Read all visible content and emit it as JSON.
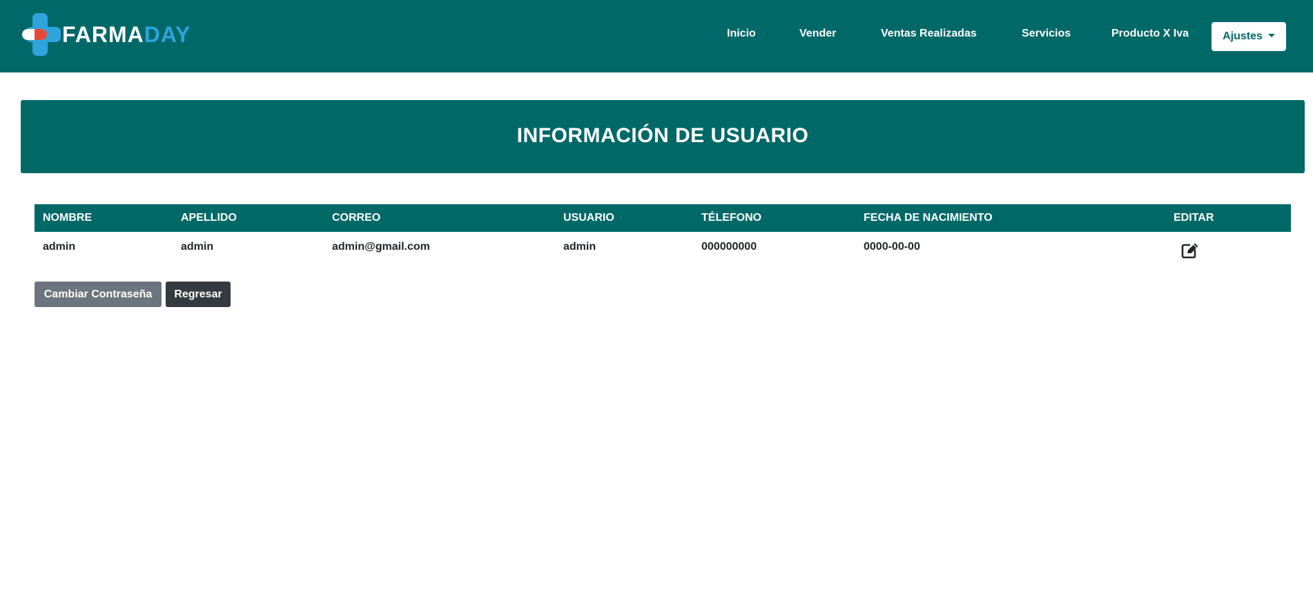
{
  "navbar": {
    "brand": {
      "part1": "FARMA",
      "part2": "DAY"
    },
    "links": [
      "Inicio",
      "Vender",
      "Ventas Realizadas",
      "Servicios",
      "Producto X Iva"
    ],
    "settings_label": "Ajustes"
  },
  "banner": {
    "title": "INFORMACIÓN DE USUARIO"
  },
  "table": {
    "headers": [
      "NOMBRE",
      "APELLIDO",
      "CORREO",
      "USUARIO",
      "TÉLEFONO",
      "FECHA DE NACIMIENTO",
      "EDITAR"
    ],
    "row": {
      "nombre": "admin",
      "apellido": "admin",
      "correo": "admin@gmail.com",
      "usuario": "admin",
      "telefono": "000000000",
      "fecha": "0000-00-00"
    }
  },
  "actions": {
    "change_password": "Cambiar Contraseña",
    "back": "Regresar"
  },
  "colors": {
    "primary": "#016868",
    "brand_accent": "#2ea3dc",
    "pill_red": "#e34a3a",
    "secondary": "#6c757d",
    "dark": "#343a40"
  },
  "icons": {
    "edit": "edit-icon",
    "dropdown": "caret-down-icon",
    "logo": "medical-cross-pill-logo"
  }
}
